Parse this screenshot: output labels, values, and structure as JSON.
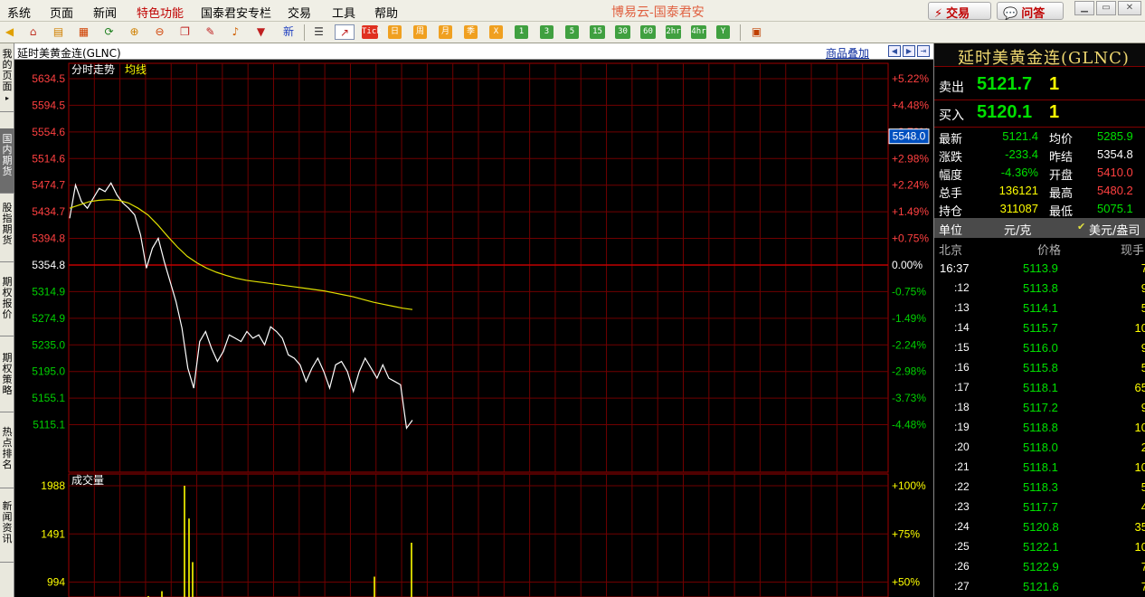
{
  "menu": [
    "系统",
    "页面",
    "新闻",
    "特色功能",
    "国泰君安专栏",
    "交易",
    "工具",
    "帮助"
  ],
  "menu_highlight": "特色功能",
  "brand": "博易云-国泰君安",
  "top_buttons": {
    "trade": "交易",
    "qa": "问答"
  },
  "toolbar": {
    "new_label": "新",
    "period_buttons": [
      "Tick",
      "日",
      "周",
      "月",
      "季",
      "X",
      "1",
      "3",
      "5",
      "15",
      "30",
      "60",
      "2hr",
      "4hr",
      "Y"
    ]
  },
  "left_tabs": [
    "我的页面",
    "国内期货",
    "股指期货",
    "期权报价",
    "期权策略",
    "热点排名",
    "新闻资讯"
  ],
  "chart_header": {
    "title": "延时美黄金连(GLNC)",
    "overlay_link": "商品叠加",
    "price_panel_label": "分时走势",
    "avg_label": "均线",
    "volume_panel_label": "成交量",
    "cursor_value": "5548.0"
  },
  "chart_data": {
    "type": "line",
    "price_axis_labels": [
      "5634.5",
      "5594.5",
      "5554.6",
      "5514.6",
      "5474.7",
      "5434.7",
      "5394.8",
      "5354.8",
      "5314.9",
      "5274.9",
      "5235.0",
      "5195.0",
      "5155.1",
      "5115.1"
    ],
    "pct_axis_labels": [
      "+5.22%",
      "+4.48%",
      "+3.73%",
      "+2.98%",
      "+2.24%",
      "+1.49%",
      "+0.75%",
      "0.00%",
      "-0.75%",
      "-1.49%",
      "-2.24%",
      "-2.98%",
      "-3.73%",
      "-4.48%"
    ],
    "ylim": [
      5075.1,
      5634.5
    ],
    "prev_settle": 5354.8,
    "volume_axis_labels": [
      "1988",
      "1491",
      "994"
    ],
    "volume_pct_labels": [
      "+100%",
      "+75%",
      "+50%"
    ],
    "volume_max": 1988,
    "series": [
      {
        "name": "分时走势",
        "values": [
          5425,
          5475,
          5450,
          5440,
          5455,
          5470,
          5465,
          5478,
          5460,
          5448,
          5440,
          5430,
          5400,
          5350,
          5380,
          5395,
          5360,
          5330,
          5300,
          5260,
          5200,
          5170,
          5240,
          5255,
          5230,
          5210,
          5225,
          5250,
          5245,
          5240,
          5255,
          5245,
          5250,
          5235,
          5262,
          5255,
          5245,
          5220,
          5215,
          5205,
          5180,
          5200,
          5215,
          5195,
          5170,
          5205,
          5210,
          5195,
          5165,
          5195,
          5215,
          5200,
          5185,
          5205,
          5185,
          5180,
          5175,
          5110,
          5122
        ]
      },
      {
        "name": "均线",
        "values": [
          5440,
          5445,
          5450,
          5452,
          5453,
          5452,
          5448,
          5440,
          5430,
          5415,
          5398,
          5382,
          5368,
          5358,
          5350,
          5344,
          5339,
          5335,
          5332,
          5330,
          5328,
          5326,
          5324,
          5322,
          5320,
          5318,
          5316,
          5313,
          5310,
          5307,
          5303,
          5299,
          5296,
          5293,
          5290,
          5288
        ]
      },
      {
        "name": "成交量",
        "values": [
          850,
          900,
          400,
          1988,
          1650,
          1200,
          780,
          500,
          360,
          300,
          1050,
          1400
        ]
      }
    ]
  },
  "quote": {
    "ask_label": "卖出",
    "ask_price": "5121.7",
    "ask_vol": "1",
    "bid_label": "买入",
    "bid_price": "5120.1",
    "bid_vol": "1",
    "rows": [
      {
        "l1": "最新",
        "v1": "5121.4",
        "l2": "均价",
        "v2": "5285.9"
      },
      {
        "l1": "涨跌",
        "v1": "-233.4",
        "l2": "昨结",
        "v2": "5354.8"
      },
      {
        "l1": "幅度",
        "v1": "-4.36%",
        "l2": "开盘",
        "v2": "5410.0"
      },
      {
        "l1": "总手",
        "v1": "136121",
        "l2": "最高",
        "v2": "5480.2"
      },
      {
        "l1": "持仓",
        "v1": "311087",
        "l2": "最低",
        "v2": "5075.1"
      }
    ],
    "unit_label": "单位",
    "unit_value": "元/克",
    "unit_alt": "美元/盎司",
    "tick_headers": [
      "北京",
      "价格",
      "现手"
    ]
  },
  "ticks": [
    {
      "t": "16:37",
      "p": "5113.9",
      "v": "7"
    },
    {
      "t": ":12",
      "p": "5113.8",
      "v": "9"
    },
    {
      "t": ":13",
      "p": "5114.1",
      "v": "5"
    },
    {
      "t": ":14",
      "p": "5115.7",
      "v": "10"
    },
    {
      "t": ":15",
      "p": "5116.0",
      "v": "9"
    },
    {
      "t": ":16",
      "p": "5115.8",
      "v": "5"
    },
    {
      "t": ":17",
      "p": "5118.1",
      "v": "65"
    },
    {
      "t": ":18",
      "p": "5117.2",
      "v": "9"
    },
    {
      "t": ":19",
      "p": "5118.8",
      "v": "10"
    },
    {
      "t": ":20",
      "p": "5118.0",
      "v": "2"
    },
    {
      "t": ":21",
      "p": "5118.1",
      "v": "10"
    },
    {
      "t": ":22",
      "p": "5118.3",
      "v": "5"
    },
    {
      "t": ":23",
      "p": "5117.7",
      "v": "4"
    },
    {
      "t": ":24",
      "p": "5120.8",
      "v": "35"
    },
    {
      "t": ":25",
      "p": "5122.1",
      "v": "10"
    },
    {
      "t": ":26",
      "p": "5122.9",
      "v": "7"
    },
    {
      "t": ":27",
      "p": "5121.6",
      "v": "7"
    }
  ]
}
